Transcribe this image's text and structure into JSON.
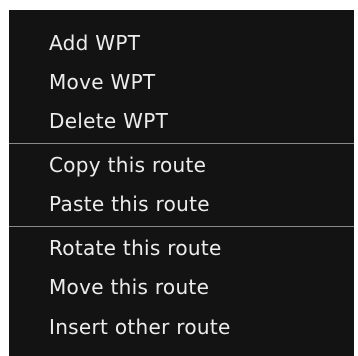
{
  "context_menu": {
    "items": [
      {
        "label": "Add WPT"
      },
      {
        "label": "Move WPT"
      },
      {
        "label": "Delete WPT"
      },
      {
        "label": "Copy this route"
      },
      {
        "label": "Paste this route"
      },
      {
        "label": "Rotate this route"
      },
      {
        "label": "Move this route"
      },
      {
        "label": "Insert other route"
      }
    ],
    "colors": {
      "background": "#131313",
      "text": "#ececec",
      "separator": "#8a8a8a"
    }
  }
}
